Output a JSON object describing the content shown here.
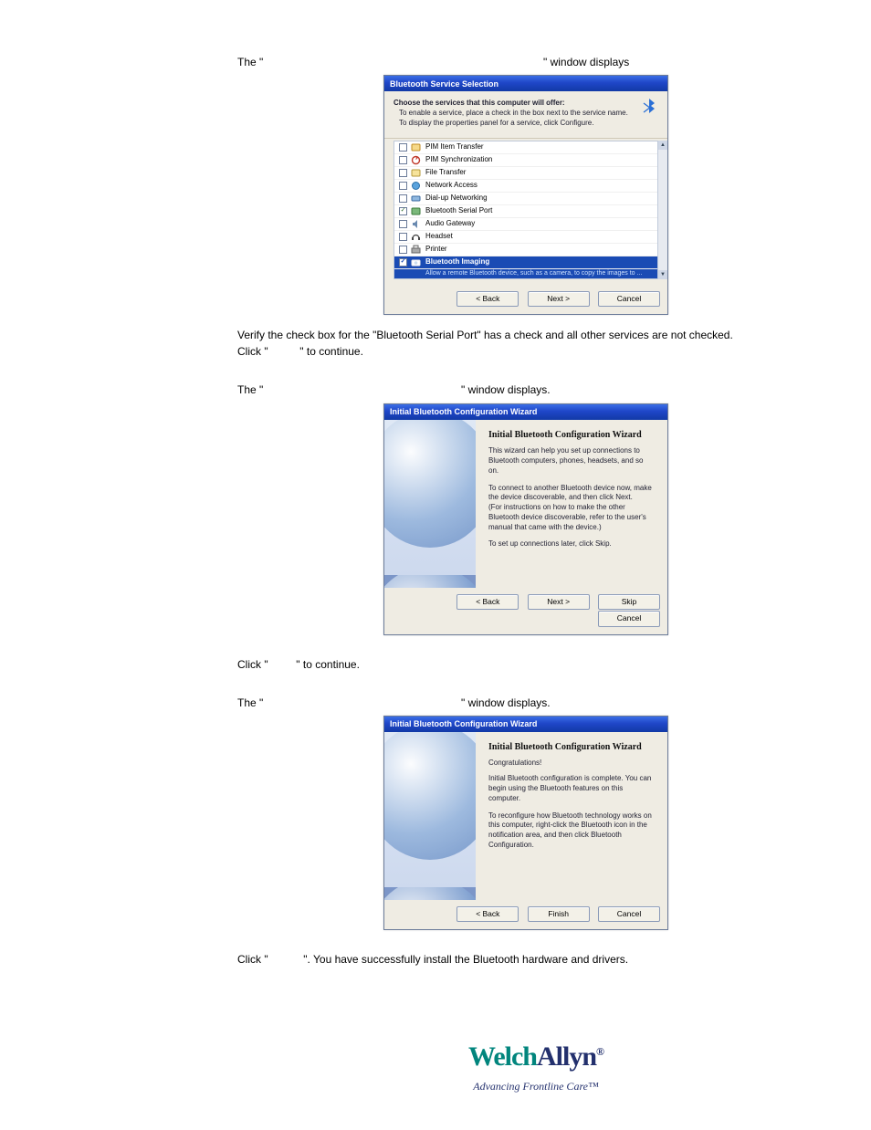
{
  "text": {
    "line1a": "The \"",
    "line1b": "\" window displays",
    "verify": "Verify the check box for the \"Bluetooth Serial Port\" has a check and all other services are not checked.",
    "clickNext1a": "Click \"",
    "clickNext1b": "\" to continue.",
    "line2a": "The \"",
    "line2b": "\" window displays.",
    "clickSkip_a": "Click \"",
    "clickSkip_b": "\" to continue.",
    "line3a": "The \"",
    "line3b": "\" window displays.",
    "clickFinish_a": "Click \"",
    "clickFinish_b": "\". You have successfully install the Bluetooth hardware and drivers."
  },
  "win1": {
    "title": "Bluetooth Service Selection",
    "hdr1": "Choose the services that this computer will offer:",
    "hdr2": "To enable a service, place a check in the box next to the service name.",
    "hdr3": "To display the properties panel for a service, click Configure.",
    "items": {
      "i0": "PIM Item Transfer",
      "i1": "PIM Synchronization",
      "i2": "File Transfer",
      "i3": "Network Access",
      "i4": "Dial-up Networking",
      "i5": "Bluetooth Serial Port",
      "i6": "Audio Gateway",
      "i7": "Headset",
      "i8": "Printer",
      "i9": "Bluetooth Imaging",
      "i9sub": "Allow a remote Bluetooth device, such as a camera, to copy the images to ..."
    },
    "back": "< Back",
    "next": "Next >",
    "cancel": "Cancel"
  },
  "win2": {
    "title": "Initial Bluetooth Configuration Wizard",
    "h": "Initial Bluetooth Configuration Wizard",
    "p1": "This wizard can help you set up connections to Bluetooth computers, phones, headsets, and so on.",
    "p2": "To connect to another Bluetooth device now, make the device discoverable, and then click Next.",
    "p3": "(For instructions on how to make the other Bluetooth device discoverable, refer to the user's manual that came with the device.)",
    "p4": "To set up connections later, click Skip.",
    "back": "< Back",
    "next": "Next >",
    "skip": "Skip",
    "cancel": "Cancel"
  },
  "win3": {
    "title": "Initial Bluetooth Configuration Wizard",
    "h": "Initial Bluetooth Configuration Wizard",
    "p1": "Congratulations!",
    "p2": "Initial Bluetooth configuration is complete. You can begin using the Bluetooth features on this computer.",
    "p3": "To reconfigure how Bluetooth technology works on this computer, right-click the Bluetooth icon in the notification area, and then click Bluetooth Configuration.",
    "back": "< Back",
    "finish": "Finish",
    "cancel": "Cancel"
  },
  "logo": {
    "a": "Welch",
    "b": "Allyn",
    "tag": "Advancing Frontline Care™"
  }
}
